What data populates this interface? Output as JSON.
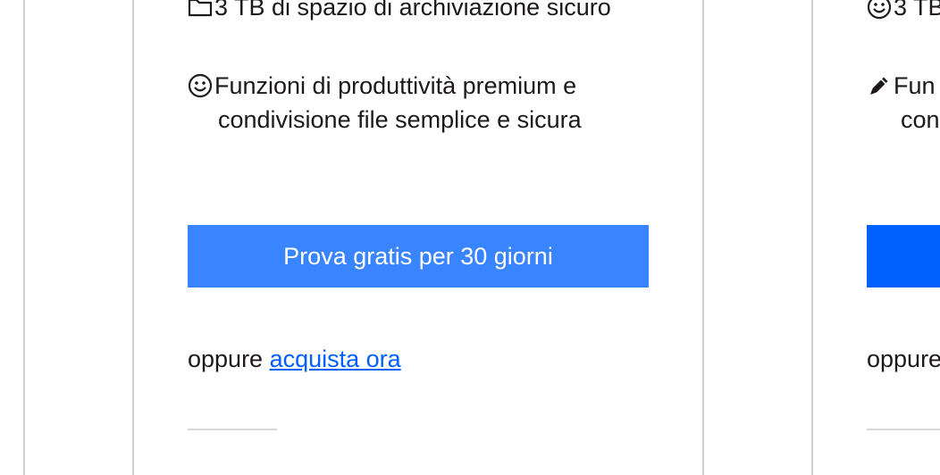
{
  "colors": {
    "button_primary": "#3984ff",
    "button_blue": "#0061fe",
    "link": "#0061fe",
    "divider": "#cfcfcf"
  },
  "card_left": {
    "feature_storage": {
      "icon": "folder-icon",
      "text": "3 TB di spazio di archiviazione sicuro"
    },
    "feature_productivity": {
      "icon": "smiley-icon",
      "line1": "Funzioni di produttività premium e",
      "line2": "condivisione file semplice e sicura"
    },
    "cta_label": "Prova gratis per 30 giorni",
    "or_text": "oppure",
    "buy_link": "acquista ora"
  },
  "card_right": {
    "feature_storage": {
      "icon": "smiley-icon",
      "text": "3 TB"
    },
    "feature_productivity": {
      "icon": "pencil-icon",
      "line1": "Fun",
      "line2": "con"
    },
    "or_text": "oppure"
  }
}
